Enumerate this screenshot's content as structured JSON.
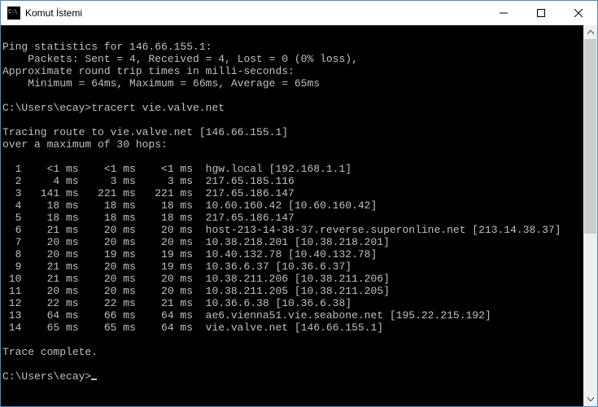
{
  "window": {
    "title": "Komut İstemi"
  },
  "ping_stats": {
    "header": "Ping statistics for 146.66.155.1:",
    "packets": "    Packets: Sent = 4, Received = 4, Lost = 0 (0% loss),",
    "rtt_header": "Approximate round trip times in milli-seconds:",
    "rtt": "    Minimum = 64ms, Maximum = 66ms, Average = 65ms"
  },
  "prompt1": {
    "path": "C:\\Users\\ecay>",
    "command": "tracert vie.valve.net"
  },
  "trace_header": {
    "line1": "Tracing route to vie.valve.net [146.66.155.1]",
    "line2": "over a maximum of 30 hops:"
  },
  "hops": [
    {
      "n": "1",
      "t1": "<1 ms",
      "t2": "<1 ms",
      "t3": "<1 ms",
      "dest": "hgw.local [192.168.1.1]"
    },
    {
      "n": "2",
      "t1": "4 ms",
      "t2": "3 ms",
      "t3": "3 ms",
      "dest": "217.65.185.116"
    },
    {
      "n": "3",
      "t1": "141 ms",
      "t2": "221 ms",
      "t3": "221 ms",
      "dest": "217.65.186.147"
    },
    {
      "n": "4",
      "t1": "18 ms",
      "t2": "18 ms",
      "t3": "18 ms",
      "dest": "10.60.160.42 [10.60.160.42]"
    },
    {
      "n": "5",
      "t1": "18 ms",
      "t2": "18 ms",
      "t3": "18 ms",
      "dest": "217.65.186.147"
    },
    {
      "n": "6",
      "t1": "21 ms",
      "t2": "20 ms",
      "t3": "20 ms",
      "dest": "host-213-14-38-37.reverse.superonline.net [213.14.38.37]"
    },
    {
      "n": "7",
      "t1": "20 ms",
      "t2": "20 ms",
      "t3": "20 ms",
      "dest": "10.38.218.201 [10.38.218.201]"
    },
    {
      "n": "8",
      "t1": "20 ms",
      "t2": "19 ms",
      "t3": "19 ms",
      "dest": "10.40.132.78 [10.40.132.78]"
    },
    {
      "n": "9",
      "t1": "21 ms",
      "t2": "20 ms",
      "t3": "19 ms",
      "dest": "10.36.6.37 [10.36.6.37]"
    },
    {
      "n": "10",
      "t1": "21 ms",
      "t2": "20 ms",
      "t3": "20 ms",
      "dest": "10.38.211.206 [10.38.211.206]"
    },
    {
      "n": "11",
      "t1": "20 ms",
      "t2": "20 ms",
      "t3": "20 ms",
      "dest": "10.38.211.205 [10.38.211.205]"
    },
    {
      "n": "12",
      "t1": "22 ms",
      "t2": "22 ms",
      "t3": "21 ms",
      "dest": "10.36.6.38 [10.36.6.38]"
    },
    {
      "n": "13",
      "t1": "64 ms",
      "t2": "66 ms",
      "t3": "64 ms",
      "dest": "ae6.vienna51.vie.seabone.net [195.22.215.192]"
    },
    {
      "n": "14",
      "t1": "65 ms",
      "t2": "65 ms",
      "t3": "64 ms",
      "dest": "vie.valve.net [146.66.155.1]"
    }
  ],
  "trace_complete": "Trace complete.",
  "prompt2": {
    "path": "C:\\Users\\ecay>"
  }
}
